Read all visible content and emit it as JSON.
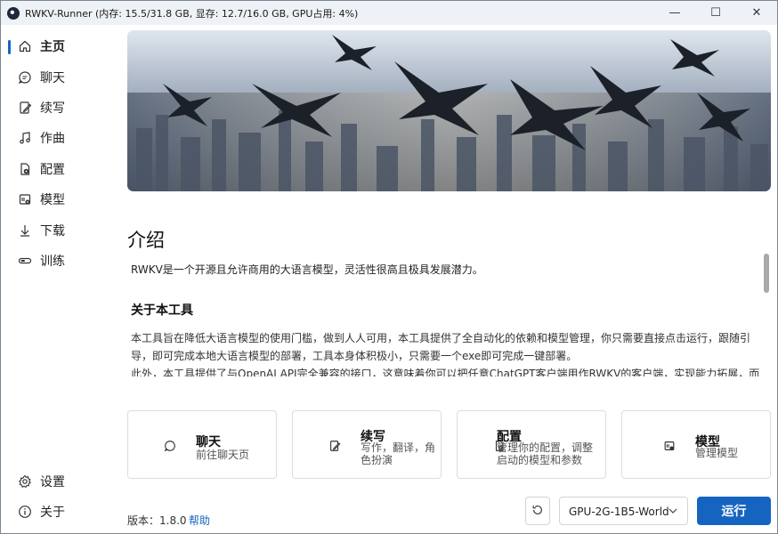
{
  "window": {
    "title": "RWKV-Runner (内存: 15.5/31.8 GB, 显存: 12.7/16.0 GB, GPU占用: 4%)",
    "controls": [
      "—",
      "☐",
      "✕"
    ]
  },
  "sidebar": {
    "items": [
      {
        "label": "主页",
        "icon": "home-icon",
        "active": true
      },
      {
        "label": "聊天",
        "icon": "chat-icon"
      },
      {
        "label": "续写",
        "icon": "write-icon"
      },
      {
        "label": "作曲",
        "icon": "music-icon"
      },
      {
        "label": "配置",
        "icon": "config-icon"
      },
      {
        "label": "模型",
        "icon": "model-icon"
      },
      {
        "label": "下载",
        "icon": "download-icon"
      },
      {
        "label": "训练",
        "icon": "train-icon"
      }
    ],
    "bottom": [
      {
        "label": "设置",
        "icon": "gear-icon"
      },
      {
        "label": "关于",
        "icon": "info-icon"
      }
    ]
  },
  "main": {
    "heading": "介绍",
    "intro": "RWKV是一个开源且允许商用的大语言模型，灵活性很高且极具发展潜力。",
    "about_heading": "关于本工具",
    "about_p1": "本工具旨在降低大语言模型的使用门槛，做到人人可用，本工具提供了全自动化的依赖和模型管理，你只需要直接点击运行，跟随引导，即可完成本地大语言模型的部署，工具本身体积极小，只需要一个exe即可完成一键部署。",
    "about_p2": "此外，本工具提供了与OpenAI API完全兼容的接口，这意味着你可以把任意ChatGPT客户端用作RWKV的客户端，实现能力拓展，而不局限于聊天。",
    "cards": [
      {
        "title": "聊天",
        "desc": "前往聊天页",
        "icon": "chat-icon"
      },
      {
        "title": "续写",
        "desc": "写作，翻译，角色扮演",
        "icon": "write-icon"
      },
      {
        "title": "配置",
        "desc": "管理你的配置，调整启动的模型和参数",
        "icon": "config-icon"
      },
      {
        "title": "模型",
        "desc": "管理模型",
        "icon": "model-icon"
      }
    ]
  },
  "footer": {
    "version": "版本：1.8.0",
    "help": "帮助",
    "model_select": "GPU-2G-1B5-World",
    "run_button": "运行"
  },
  "colors": {
    "accent": "#1565c0"
  }
}
